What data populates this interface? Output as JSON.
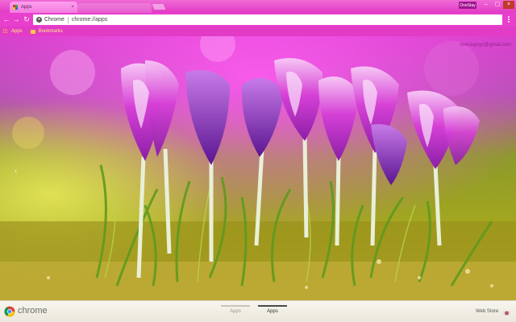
{
  "window": {
    "tab_title": "Apps",
    "tab_close_glyph": "×",
    "profile_label": "OneStay",
    "controls": {
      "minimize": "–",
      "maximize": "▢",
      "close": "×"
    }
  },
  "toolbar": {
    "back_glyph": "←",
    "forward_glyph": "→",
    "reload_glyph": "↻",
    "site_label": "Chrome",
    "url": "chrome://apps"
  },
  "bookmarks_bar": {
    "items": [
      {
        "label": "Apps",
        "icon": "apps-grid-icon"
      },
      {
        "label": "Bookmarks",
        "icon": "folder-icon"
      }
    ]
  },
  "content": {
    "account_email": "onestayxyz@gmail.com",
    "prev_arrow": "‹"
  },
  "footer": {
    "brand": "chrome",
    "pages": [
      {
        "label": "Apps",
        "active": false
      },
      {
        "label": "Apps",
        "active": true
      }
    ],
    "webstore_label": "Web Store"
  },
  "colors": {
    "frame": "#e23bc6",
    "tab": "#f27ddf",
    "footer": "#f2efe6",
    "page_active": "#4a4a4a",
    "page_inactive": "#c8c4b8"
  }
}
